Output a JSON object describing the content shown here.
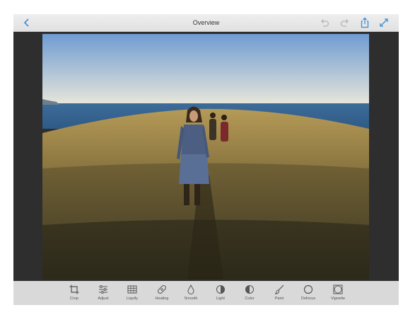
{
  "header": {
    "title": "Overview"
  },
  "toolbar": {
    "tools": [
      {
        "label": "Crop",
        "icon": "crop-icon"
      },
      {
        "label": "Adjust",
        "icon": "sliders-icon"
      },
      {
        "label": "Liquify",
        "icon": "grid-icon"
      },
      {
        "label": "Healing",
        "icon": "bandage-icon"
      },
      {
        "label": "Smooth",
        "icon": "droplet-icon"
      },
      {
        "label": "Light",
        "icon": "half-circle-icon"
      },
      {
        "label": "Color",
        "icon": "half-circle-color-icon"
      },
      {
        "label": "Paint",
        "icon": "brush-icon"
      },
      {
        "label": "Defocus",
        "icon": "circle-icon"
      },
      {
        "label": "Vignette",
        "icon": "vignette-icon"
      }
    ]
  },
  "colors": {
    "accent": "#3a8ed6",
    "disabled": "#b5b5b5",
    "toolbar_bg": "#d9d9d9"
  }
}
